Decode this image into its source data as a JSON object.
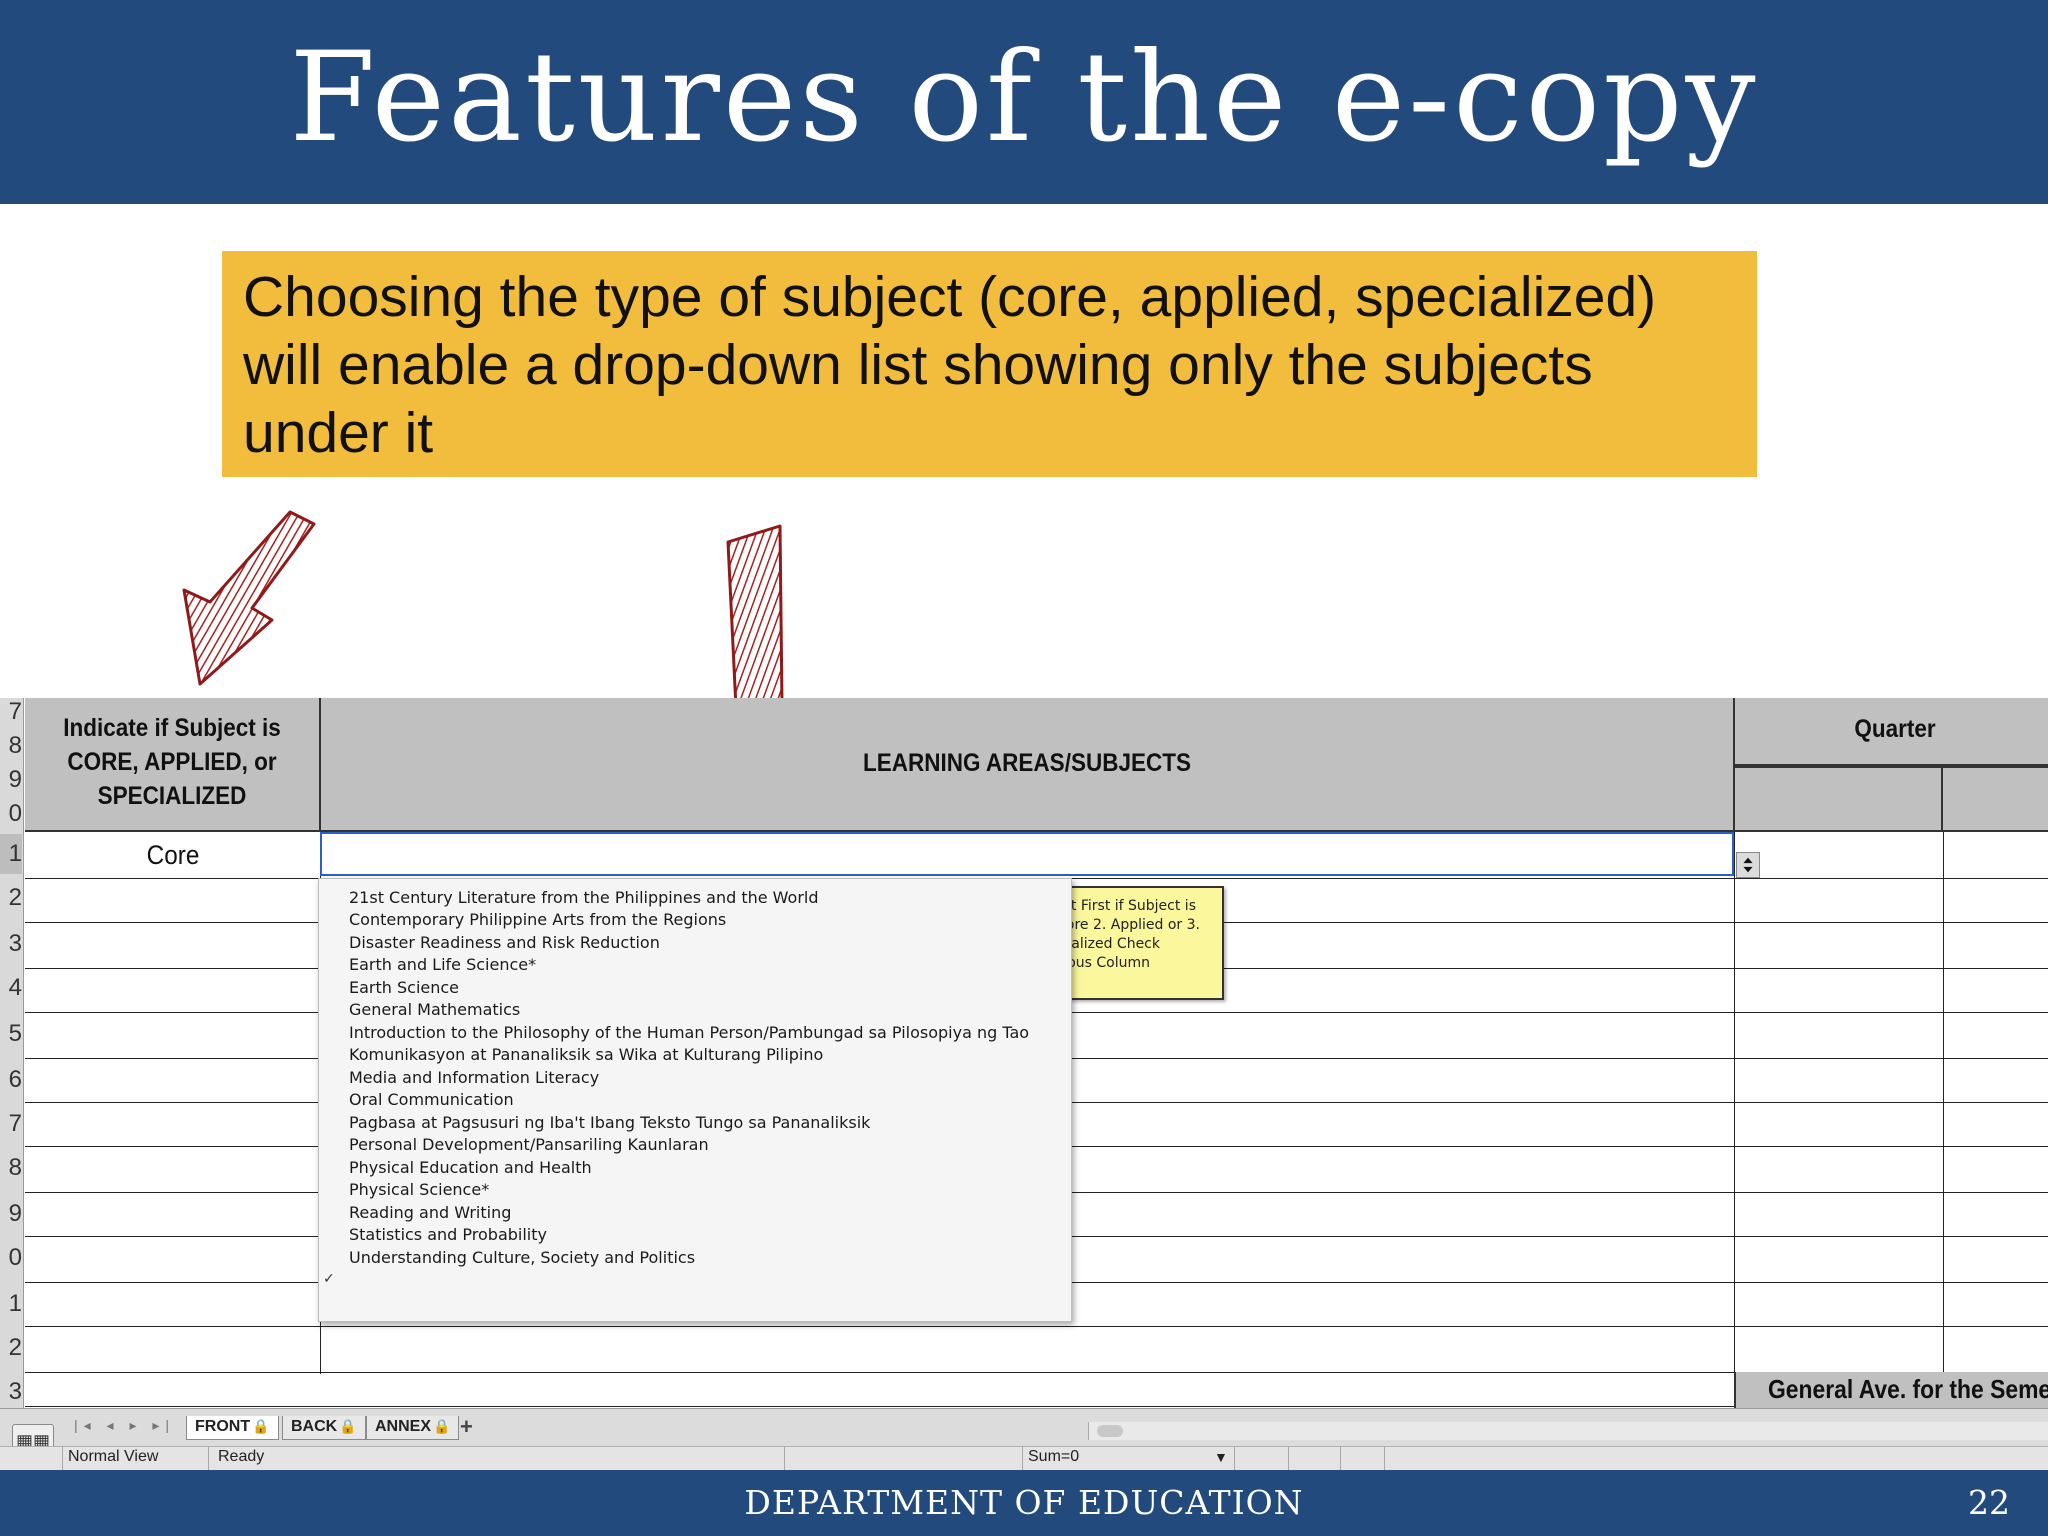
{
  "slide": {
    "title": "Features of the e-copy",
    "callout": "Choosing the type of subject (core, applied, specialized) will enable a drop-down list showing only the subjects under it",
    "footer": "DEPARTMENT OF EDUCATION",
    "page_number": "22"
  },
  "sheet": {
    "row_numbers": [
      "7",
      "8",
      "9",
      "0",
      "1",
      "2",
      "3",
      "4",
      "5",
      "6",
      "7",
      "8",
      "9",
      "0",
      "1",
      "2",
      "3"
    ],
    "header_type": [
      "Indicate if Subject is",
      "CORE, APPLIED, or",
      "SPECIALIZED"
    ],
    "header_subjects": "LEARNING AREAS/SUBJECTS",
    "header_quarter": "Quarter",
    "type_value": "Core",
    "dropdown_items": [
      "21st Century Literature from the Philippines and the World",
      "Contemporary Philippine Arts from the Regions",
      "Disaster Readiness and Risk Reduction",
      "Earth and Life Science*",
      "Earth Science",
      "General Mathematics",
      "Introduction to the Philosophy of the Human Person/Pambungad sa Pilosopiya ng Tao",
      "Komunikasyon at Pananaliksik sa Wika at Kulturang Pilipino",
      "Media and Information Literacy",
      "Oral Communication",
      "Pagbasa at Pagsusuri ng Iba't Ibang Teksto Tungo sa Pananaliksik",
      "Personal Development/Pansariling Kaunlaran",
      "Physical Education and Health",
      "Physical Science*",
      "Reading and Writing",
      "Statistics and Probability",
      "Understanding Culture, Society and Politics"
    ],
    "dropdown_check": "✓",
    "note_lines": [
      "ct First if Subject is",
      "ore 2. Applied or 3.",
      "ialized Check",
      "ous Column"
    ],
    "general_average": "General Ave. for the Semester"
  },
  "excel": {
    "tabs": [
      "FRONT",
      "BACK",
      "ANNEX"
    ],
    "add_tab": "+",
    "nav_arrows": "|◂ ◂ ▸ ▸|",
    "view_label": "Normal View",
    "status": "Ready",
    "sum": "Sum=0"
  },
  "colors": {
    "header_blue": "#224a7d",
    "callout_yellow": "#f2bd3c",
    "arrow_red": "#a8201f",
    "note_yellow": "#fbf79d"
  },
  "icons": [
    "hand-drawn-arrow",
    "dropdown-stepper-icon",
    "lock-icon",
    "normal-view-icon"
  ]
}
